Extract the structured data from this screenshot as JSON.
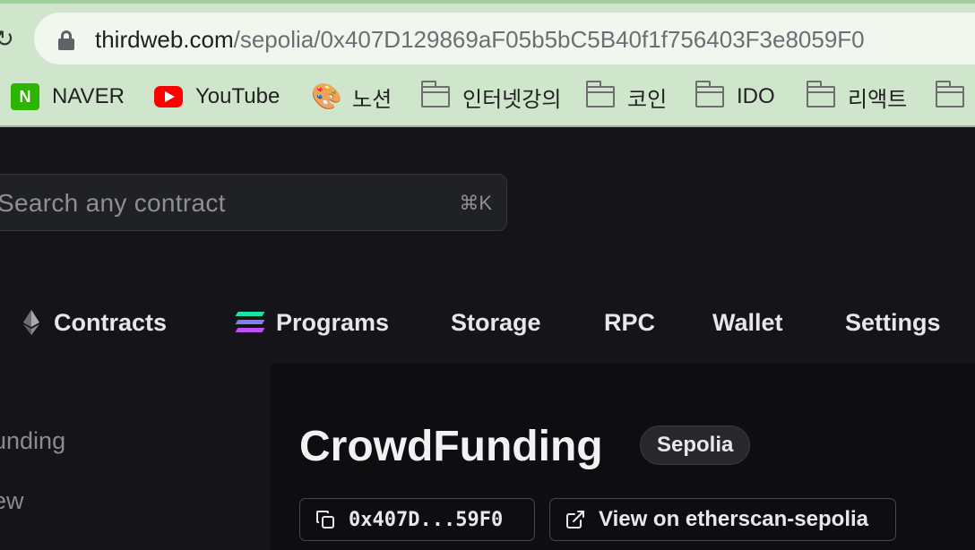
{
  "browser": {
    "reload_glyph": "↻",
    "url_host": "thirdweb.com",
    "url_path": "/sepolia/0x407D129869aF05b5bC5B40f1f756403F3e8059F0",
    "bookmarks": [
      {
        "label": "NAVER",
        "icon": "naver-icon",
        "icon_text": "N"
      },
      {
        "label": "YouTube",
        "icon": "youtube-icon"
      },
      {
        "label": "노션",
        "icon": "palette-icon",
        "icon_text": "🎨"
      },
      {
        "label": "인터넷강의",
        "icon": "folder-icon"
      },
      {
        "label": "코인",
        "icon": "folder-icon"
      },
      {
        "label": "IDO",
        "icon": "folder-icon"
      },
      {
        "label": "리액트",
        "icon": "folder-icon"
      },
      {
        "label": "",
        "icon": "folder-icon"
      }
    ]
  },
  "search": {
    "placeholder": "Search any contract",
    "shortcut": "⌘K"
  },
  "nav": {
    "items": [
      {
        "label": "Contracts",
        "icon": "ethereum-icon"
      },
      {
        "label": "Programs",
        "icon": "solana-icon"
      },
      {
        "label": "Storage"
      },
      {
        "label": "RPC"
      },
      {
        "label": "Wallet"
      },
      {
        "label": "Settings"
      }
    ]
  },
  "sidebar": {
    "items": [
      {
        "label": "unding"
      },
      {
        "label": "ew"
      }
    ]
  },
  "contract": {
    "name": "CrowdFunding",
    "network": "Sepolia",
    "address_short": "0x407D...59F0",
    "explorer_label": "View on etherscan-sepolia"
  },
  "colors": {
    "chrome_bg": "#cfe6cc",
    "app_bg": "#151519",
    "main_bg": "#0e0e11",
    "text_primary": "#e7e7ea",
    "text_muted": "#8e8f94"
  }
}
